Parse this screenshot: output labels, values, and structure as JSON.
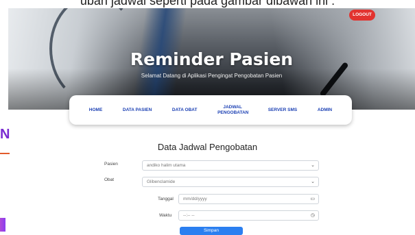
{
  "caption": "ubah jadwal seperti pada gambar dibawah ini :",
  "header": {
    "title": "Reminder Pasien",
    "subtitle": "Selamat Datang di Aplikasi Pengingat Pengobatan Pasien",
    "logout_label": "LOGOUT"
  },
  "nav": {
    "items": [
      {
        "label": "HOME"
      },
      {
        "label": "DATA PASIEN"
      },
      {
        "label": "DATA OBAT"
      },
      {
        "label": "JADWAL PENGOBATAN"
      },
      {
        "label": "SERVER SMS"
      },
      {
        "label": "ADMIN"
      }
    ]
  },
  "side_fragment": "N",
  "form": {
    "title": "Data Jadwal Pengobatan",
    "pasien": {
      "label": "Pasien",
      "value": "andiko halim utama"
    },
    "obat": {
      "label": "Obat",
      "value": "Glibenclamide"
    },
    "tanggal": {
      "label": "Tanggal",
      "placeholder": "mm/dd/yyyy"
    },
    "waktu": {
      "label": "Waktu",
      "placeholder": "--:-- --"
    },
    "submit_label": "Simpan"
  },
  "colors": {
    "nav_text": "#1a3fb3",
    "logout_bg": "#e2332f",
    "submit_bg": "#2b7ff0"
  },
  "icons": {
    "select_arrow": "chevron-down-icon",
    "calendar": "calendar-icon",
    "clock": "clock-icon"
  }
}
